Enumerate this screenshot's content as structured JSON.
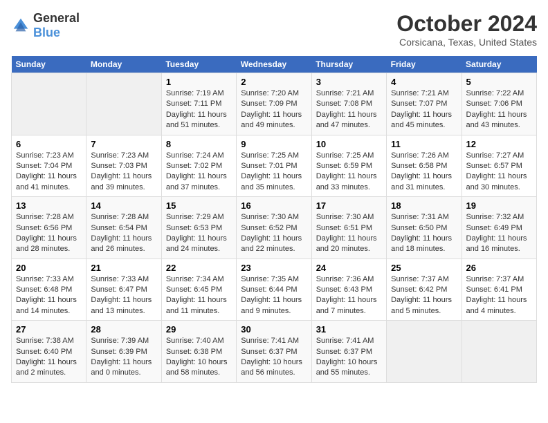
{
  "logo": {
    "general": "General",
    "blue": "Blue"
  },
  "title": "October 2024",
  "subtitle": "Corsicana, Texas, United States",
  "headers": [
    "Sunday",
    "Monday",
    "Tuesday",
    "Wednesday",
    "Thursday",
    "Friday",
    "Saturday"
  ],
  "rows": [
    [
      {
        "day": "",
        "info": "",
        "empty": true
      },
      {
        "day": "",
        "info": "",
        "empty": true
      },
      {
        "day": "1",
        "info": "Sunrise: 7:19 AM\nSunset: 7:11 PM\nDaylight: 11 hours and 51 minutes.",
        "empty": false
      },
      {
        "day": "2",
        "info": "Sunrise: 7:20 AM\nSunset: 7:09 PM\nDaylight: 11 hours and 49 minutes.",
        "empty": false
      },
      {
        "day": "3",
        "info": "Sunrise: 7:21 AM\nSunset: 7:08 PM\nDaylight: 11 hours and 47 minutes.",
        "empty": false
      },
      {
        "day": "4",
        "info": "Sunrise: 7:21 AM\nSunset: 7:07 PM\nDaylight: 11 hours and 45 minutes.",
        "empty": false
      },
      {
        "day": "5",
        "info": "Sunrise: 7:22 AM\nSunset: 7:06 PM\nDaylight: 11 hours and 43 minutes.",
        "empty": false
      }
    ],
    [
      {
        "day": "6",
        "info": "Sunrise: 7:23 AM\nSunset: 7:04 PM\nDaylight: 11 hours and 41 minutes.",
        "empty": false
      },
      {
        "day": "7",
        "info": "Sunrise: 7:23 AM\nSunset: 7:03 PM\nDaylight: 11 hours and 39 minutes.",
        "empty": false
      },
      {
        "day": "8",
        "info": "Sunrise: 7:24 AM\nSunset: 7:02 PM\nDaylight: 11 hours and 37 minutes.",
        "empty": false
      },
      {
        "day": "9",
        "info": "Sunrise: 7:25 AM\nSunset: 7:01 PM\nDaylight: 11 hours and 35 minutes.",
        "empty": false
      },
      {
        "day": "10",
        "info": "Sunrise: 7:25 AM\nSunset: 6:59 PM\nDaylight: 11 hours and 33 minutes.",
        "empty": false
      },
      {
        "day": "11",
        "info": "Sunrise: 7:26 AM\nSunset: 6:58 PM\nDaylight: 11 hours and 31 minutes.",
        "empty": false
      },
      {
        "day": "12",
        "info": "Sunrise: 7:27 AM\nSunset: 6:57 PM\nDaylight: 11 hours and 30 minutes.",
        "empty": false
      }
    ],
    [
      {
        "day": "13",
        "info": "Sunrise: 7:28 AM\nSunset: 6:56 PM\nDaylight: 11 hours and 28 minutes.",
        "empty": false
      },
      {
        "day": "14",
        "info": "Sunrise: 7:28 AM\nSunset: 6:54 PM\nDaylight: 11 hours and 26 minutes.",
        "empty": false
      },
      {
        "day": "15",
        "info": "Sunrise: 7:29 AM\nSunset: 6:53 PM\nDaylight: 11 hours and 24 minutes.",
        "empty": false
      },
      {
        "day": "16",
        "info": "Sunrise: 7:30 AM\nSunset: 6:52 PM\nDaylight: 11 hours and 22 minutes.",
        "empty": false
      },
      {
        "day": "17",
        "info": "Sunrise: 7:30 AM\nSunset: 6:51 PM\nDaylight: 11 hours and 20 minutes.",
        "empty": false
      },
      {
        "day": "18",
        "info": "Sunrise: 7:31 AM\nSunset: 6:50 PM\nDaylight: 11 hours and 18 minutes.",
        "empty": false
      },
      {
        "day": "19",
        "info": "Sunrise: 7:32 AM\nSunset: 6:49 PM\nDaylight: 11 hours and 16 minutes.",
        "empty": false
      }
    ],
    [
      {
        "day": "20",
        "info": "Sunrise: 7:33 AM\nSunset: 6:48 PM\nDaylight: 11 hours and 14 minutes.",
        "empty": false
      },
      {
        "day": "21",
        "info": "Sunrise: 7:33 AM\nSunset: 6:47 PM\nDaylight: 11 hours and 13 minutes.",
        "empty": false
      },
      {
        "day": "22",
        "info": "Sunrise: 7:34 AM\nSunset: 6:45 PM\nDaylight: 11 hours and 11 minutes.",
        "empty": false
      },
      {
        "day": "23",
        "info": "Sunrise: 7:35 AM\nSunset: 6:44 PM\nDaylight: 11 hours and 9 minutes.",
        "empty": false
      },
      {
        "day": "24",
        "info": "Sunrise: 7:36 AM\nSunset: 6:43 PM\nDaylight: 11 hours and 7 minutes.",
        "empty": false
      },
      {
        "day": "25",
        "info": "Sunrise: 7:37 AM\nSunset: 6:42 PM\nDaylight: 11 hours and 5 minutes.",
        "empty": false
      },
      {
        "day": "26",
        "info": "Sunrise: 7:37 AM\nSunset: 6:41 PM\nDaylight: 11 hours and 4 minutes.",
        "empty": false
      }
    ],
    [
      {
        "day": "27",
        "info": "Sunrise: 7:38 AM\nSunset: 6:40 PM\nDaylight: 11 hours and 2 minutes.",
        "empty": false
      },
      {
        "day": "28",
        "info": "Sunrise: 7:39 AM\nSunset: 6:39 PM\nDaylight: 11 hours and 0 minutes.",
        "empty": false
      },
      {
        "day": "29",
        "info": "Sunrise: 7:40 AM\nSunset: 6:38 PM\nDaylight: 10 hours and 58 minutes.",
        "empty": false
      },
      {
        "day": "30",
        "info": "Sunrise: 7:41 AM\nSunset: 6:37 PM\nDaylight: 10 hours and 56 minutes.",
        "empty": false
      },
      {
        "day": "31",
        "info": "Sunrise: 7:41 AM\nSunset: 6:37 PM\nDaylight: 10 hours and 55 minutes.",
        "empty": false
      },
      {
        "day": "",
        "info": "",
        "empty": true
      },
      {
        "day": "",
        "info": "",
        "empty": true
      }
    ]
  ]
}
